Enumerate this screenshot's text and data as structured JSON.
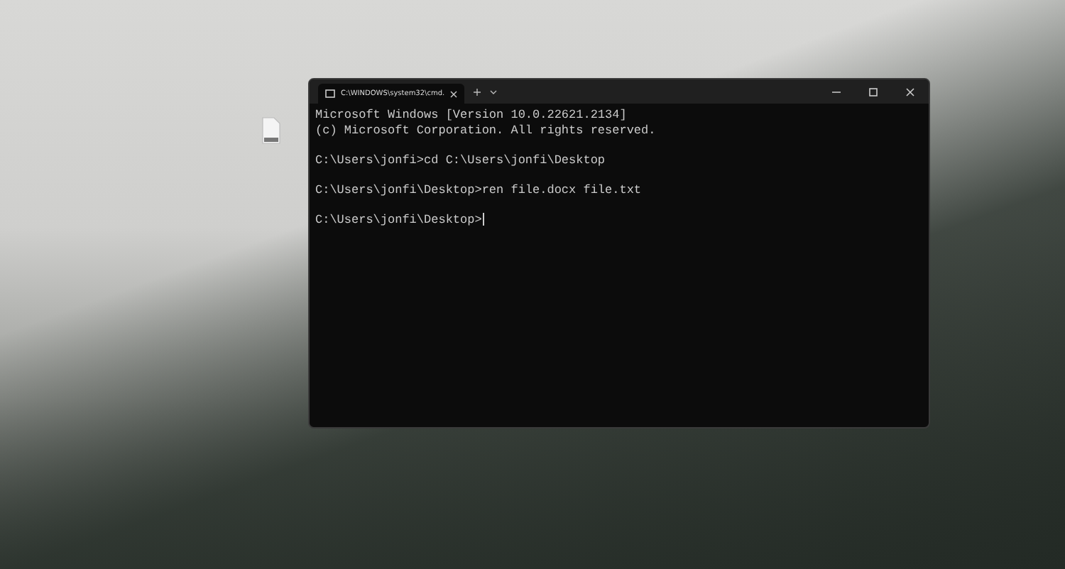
{
  "terminal": {
    "tab_title": "C:\\WINDOWS\\system32\\cmd.",
    "blocks": [
      [
        "Microsoft Windows [Version 10.0.22621.2134]",
        "(c) Microsoft Corporation. All rights reserved."
      ],
      [
        "C:\\Users\\jonfi>cd C:\\Users\\jonfi\\Desktop"
      ],
      [
        "C:\\Users\\jonfi\\Desktop>ren file.docx file.txt"
      ],
      [
        "C:\\Users\\jonfi\\Desktop>"
      ]
    ]
  }
}
